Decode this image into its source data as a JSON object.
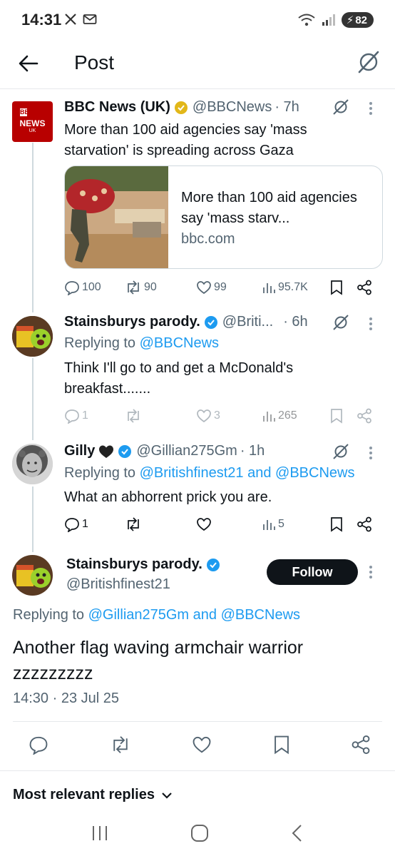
{
  "status_bar": {
    "time": "14:31",
    "battery": "82"
  },
  "header": {
    "title": "Post"
  },
  "thread": [
    {
      "author": "BBC News (UK)",
      "handle": "@BBCNews",
      "time": "· 7h",
      "text": "More than 100 aid agencies say 'mass starvation' is spreading across Gaza",
      "avatar_text": [
        "BBC",
        "NEWS",
        "UK"
      ],
      "card": {
        "title": "More than 100 aid agencies say 'mass starv...",
        "domain": "bbc.com"
      },
      "actions": {
        "replies": "100",
        "reposts": "90",
        "likes": "99",
        "views": "95.7K"
      }
    },
    {
      "author": "Stainsburys parody.",
      "handle": "@Briti...",
      "time": "· 6h",
      "replying_prefix": "Replying to",
      "replying_to": "@BBCNews",
      "text": "Think I'll go to and get a McDonald's breakfast.......",
      "actions": {
        "replies": "1",
        "reposts": "",
        "likes": "3",
        "views": "265"
      }
    },
    {
      "author": "Gilly",
      "handle": "@Gillian275Gm",
      "time": "· 1h",
      "replying_prefix": "Replying to",
      "replying_to": "@Britishfinest21 and @BBCNews",
      "text": "What an abhorrent prick you are.",
      "actions": {
        "replies": "1",
        "reposts": "",
        "likes": "",
        "views": "5"
      }
    }
  ],
  "main_post": {
    "author": "Stainsburys parody.",
    "handle": "@Britishfinest21",
    "follow_label": "Follow",
    "replying_prefix": "Replying to",
    "replying_to": "@Gillian275Gm and @BBCNews",
    "text_line1": "Another flag waving armchair warrior",
    "text_line2": "zzzzzzzzz",
    "timestamp": "14:30 · 23 Jul 25"
  },
  "replies_sort": {
    "label": "Most relevant replies"
  },
  "colors": {
    "accent": "#1d9bf0",
    "verified": "#1d9bf0",
    "gold_badge": "#e2b719",
    "bbc_red": "#b80000"
  }
}
